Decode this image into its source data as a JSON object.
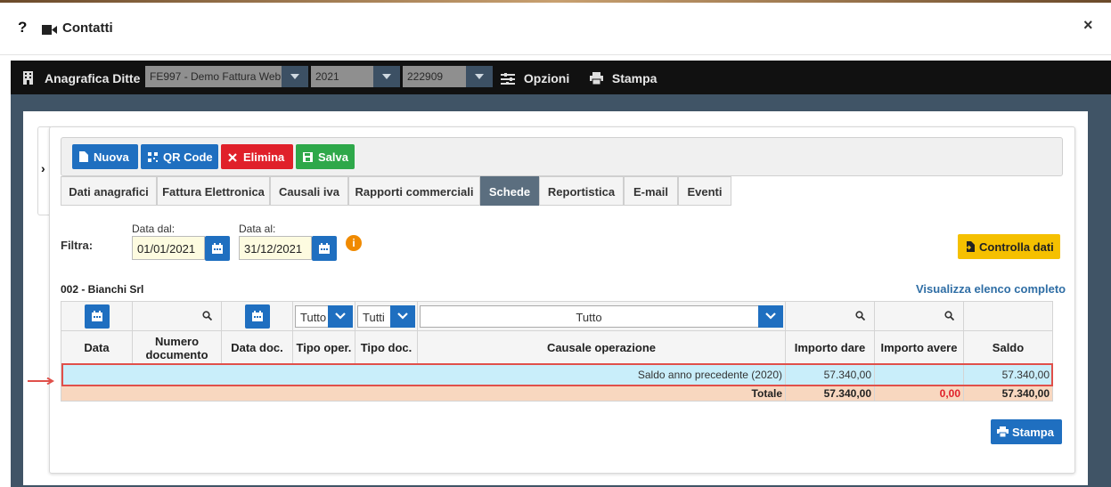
{
  "window": {
    "help": "?",
    "title": "Contatti",
    "close": "×"
  },
  "header": {
    "app_title": "Anagrafica Ditte",
    "company": "FE997 - Demo Fattura Web",
    "year": "2021",
    "code": "222909",
    "options": "Opzioni",
    "print": "Stampa"
  },
  "toolbar": {
    "new": "Nuova",
    "qr": "QR Code",
    "delete": "Elimina",
    "save": "Salva"
  },
  "tabs": [
    "Dati anagrafici",
    "Fattura Elettronica",
    "Causali iva",
    "Rapporti commerciali",
    "Schede",
    "Reportistica",
    "E-mail",
    "Eventi"
  ],
  "active_tab": "Schede",
  "filter": {
    "label": "Filtra:",
    "from_label": "Data dal:",
    "from_value": "01/01/2021",
    "to_label": "Data al:",
    "to_value": "31/12/2021",
    "check_button": "Controlla dati"
  },
  "account": {
    "name": "002 - Bianchi Srl",
    "view_all": "Visualizza elenco completo"
  },
  "grid": {
    "filters": {
      "tipo_oper": "Tutto",
      "tipo_doc": "Tutti",
      "causale": "Tutto"
    },
    "columns": [
      "Data",
      "Numero documento",
      "Data doc.",
      "Tipo oper.",
      "Tipo doc.",
      "Causale operazione",
      "Importo dare",
      "Importo avere",
      "Saldo"
    ],
    "row": {
      "causale": "Saldo anno precedente (2020)",
      "dare": "57.340,00",
      "avere": "",
      "saldo": "57.340,00"
    },
    "totals": {
      "label": "Totale",
      "dare": "57.340,00",
      "avere": "0,00",
      "saldo": "57.340,00"
    }
  },
  "footer": {
    "print": "Stampa"
  },
  "colors": {
    "primary": "#1f6fc0",
    "danger": "#e0202a",
    "success": "#2ea84a",
    "warning": "#f5c000",
    "highlight": "#e0504a"
  }
}
